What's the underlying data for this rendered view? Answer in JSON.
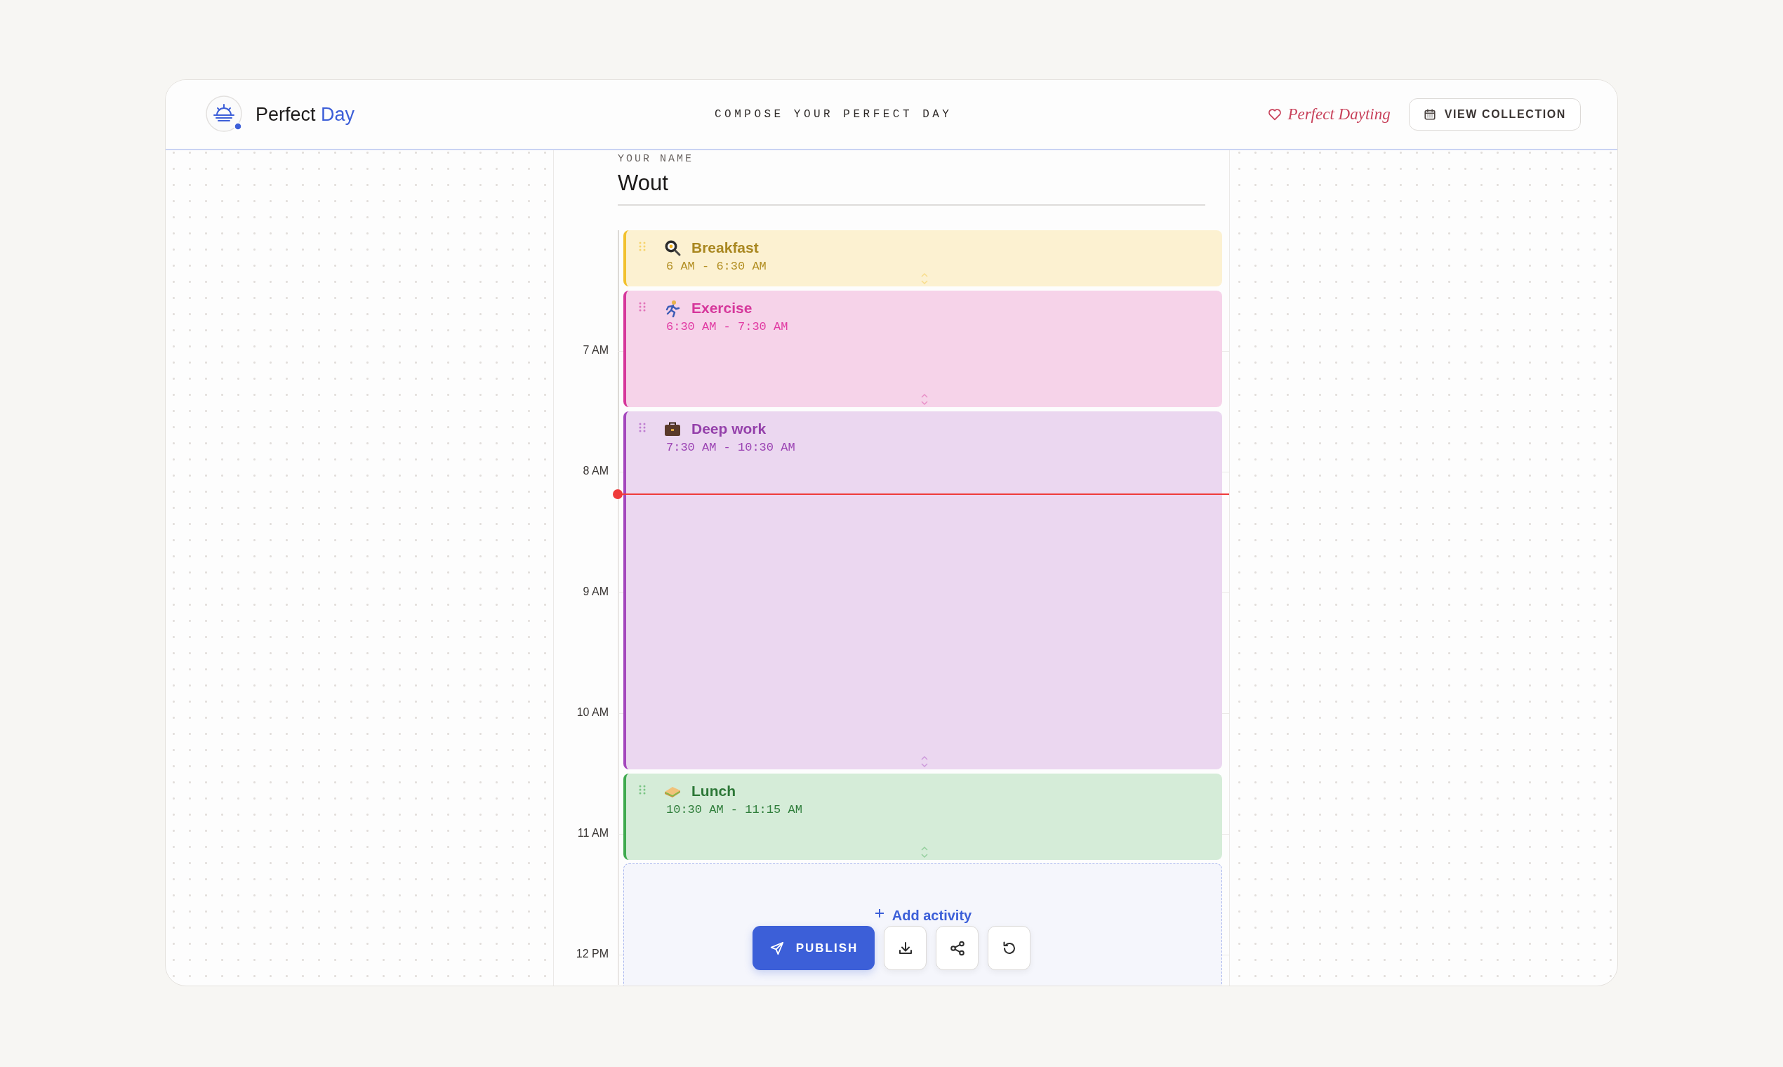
{
  "header": {
    "brand": {
      "first": "Perfect",
      "second": "Day"
    },
    "tagline": "COMPOSE YOUR PERFECT DAY",
    "link": "Perfect Dayting",
    "button": "VIEW COLLECTION"
  },
  "name_field": {
    "label": "YOUR NAME",
    "value": "Wout"
  },
  "hours": [
    "7 AM",
    "8 AM",
    "9 AM",
    "10 AM",
    "11 AM",
    "12 PM"
  ],
  "activities": [
    {
      "kind": "cooking",
      "title": "Breakfast",
      "time": "6 AM - 6:30 AM",
      "color": "#f2c12e"
    },
    {
      "kind": "sport",
      "title": "Exercise",
      "time": "6:30 AM - 7:30 AM",
      "color": "#d6379b"
    },
    {
      "kind": "work",
      "title": "Deep work",
      "time": "7:30 AM - 10:30 AM",
      "color": "#a447bd"
    },
    {
      "kind": "food",
      "title": "Lunch",
      "time": "10:30 AM - 11:15 AM",
      "color": "#3faa4f"
    }
  ],
  "now_line": {
    "level": 0.35
  },
  "add_activity": "Add activity",
  "actions": {
    "publish": "PUBLISH"
  }
}
